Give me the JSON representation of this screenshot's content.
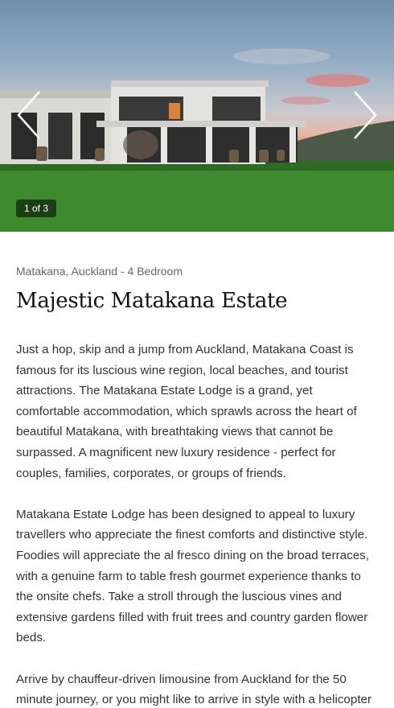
{
  "gallery": {
    "counter": "1 of 3",
    "prev_icon": "chevron-left-icon",
    "next_icon": "chevron-right-icon"
  },
  "listing": {
    "meta": "Matakana, Auckland - 4 Bedroom",
    "title": "Majestic Matakana Estate",
    "paragraphs": [
      "Just a hop, skip and a jump from Auckland, Matakana Coast is famous for its luscious wine region, local beaches, and tourist attractions. The Matakana Estate Lodge is a grand, yet comfortable accommodation, which sprawls across the heart of beautiful Matakana, with breathtaking views that cannot be surpassed. A magnificent new luxury residence - perfect for couples, families, corporates, or groups of friends.",
      "Matakana Estate Lodge has been designed to appeal to luxury travellers who appreciate the finest comforts and distinctive style. Foodies will appreciate the al fresco dining on the broad terraces, with a genuine farm to table fresh gourmet experience thanks to the onsite chefs. Take a stroll through the luscious vines and extensive gardens filled with fruit trees and country garden flower beds.",
      "Arrive by chauffeur-driven limousine from Auckland for the 50 minute journey, or you might like to arrive in style with a helicopter touching down at your leisure."
    ]
  }
}
